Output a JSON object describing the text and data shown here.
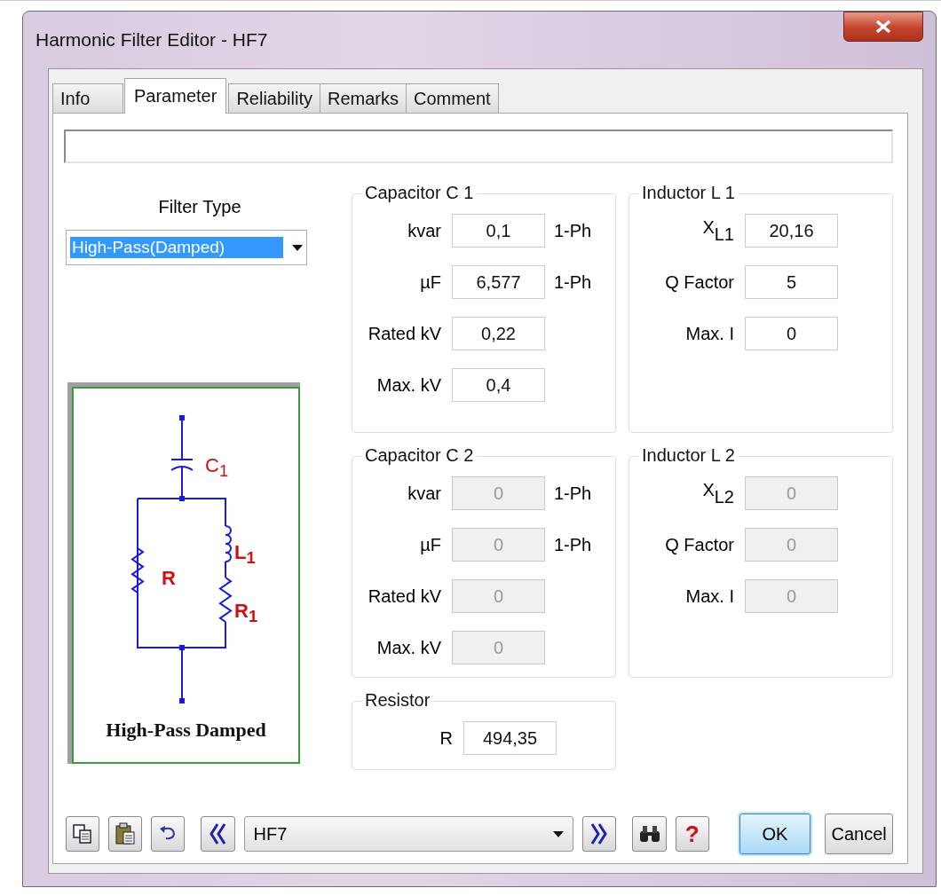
{
  "window": {
    "title": "Harmonic Filter Editor - HF7"
  },
  "tabs": [
    {
      "label": "Info",
      "selected": false
    },
    {
      "label": "Parameter",
      "selected": true
    },
    {
      "label": "Reliability",
      "selected": false
    },
    {
      "label": "Remarks",
      "selected": false
    },
    {
      "label": "Comment",
      "selected": false
    }
  ],
  "filter_type": {
    "label": "Filter Type",
    "value": "High-Pass(Damped)"
  },
  "diagram": {
    "labels": [
      "C$_{1}$",
      "L$_{1}$",
      "R",
      "R$_{1}$"
    ],
    "caption": "High-Pass Damped"
  },
  "groups": [
    {
      "title": "Capacitor C 1",
      "fields": [
        {
          "label": "kvar",
          "value": "0,1",
          "unit": "1-Ph",
          "disabled": false
        },
        {
          "label": "µF",
          "value": "6,577",
          "unit": "1-Ph",
          "disabled": false
        },
        {
          "label": "Rated kV",
          "value": "0,22",
          "disabled": false
        },
        {
          "label": "Max. kV",
          "value": "0,4",
          "disabled": false
        }
      ]
    },
    {
      "title": "Inductor L 1",
      "fields": [
        {
          "label": "X$_{L1}$",
          "value": "20,16",
          "disabled": false
        },
        {
          "label": "Q Factor",
          "value": "5",
          "disabled": false
        },
        {
          "label": "Max. I",
          "value": "0",
          "disabled": false
        }
      ]
    },
    {
      "title": "Capacitor C 2",
      "fields": [
        {
          "label": "kvar",
          "value": "0",
          "unit": "1-Ph",
          "disabled": true
        },
        {
          "label": "µF",
          "value": "0",
          "unit": "1-Ph",
          "disabled": true
        },
        {
          "label": "Rated kV",
          "value": "0",
          "disabled": true
        },
        {
          "label": "Max. kV",
          "value": "0",
          "disabled": true
        }
      ]
    },
    {
      "title": "Inductor L 2",
      "fields": [
        {
          "label": "X$_{L2}$",
          "value": "0",
          "disabled": true
        },
        {
          "label": "Q Factor",
          "value": "0",
          "disabled": true
        },
        {
          "label": "Max. I",
          "value": "0",
          "disabled": true
        }
      ]
    },
    {
      "title": "Resistor",
      "fields": [
        {
          "label": "R",
          "value": "494,35",
          "disabled": false
        }
      ]
    }
  ],
  "toolbar": {
    "record": "HF7",
    "help": "?",
    "ok": "OK",
    "cancel": "Cancel"
  }
}
